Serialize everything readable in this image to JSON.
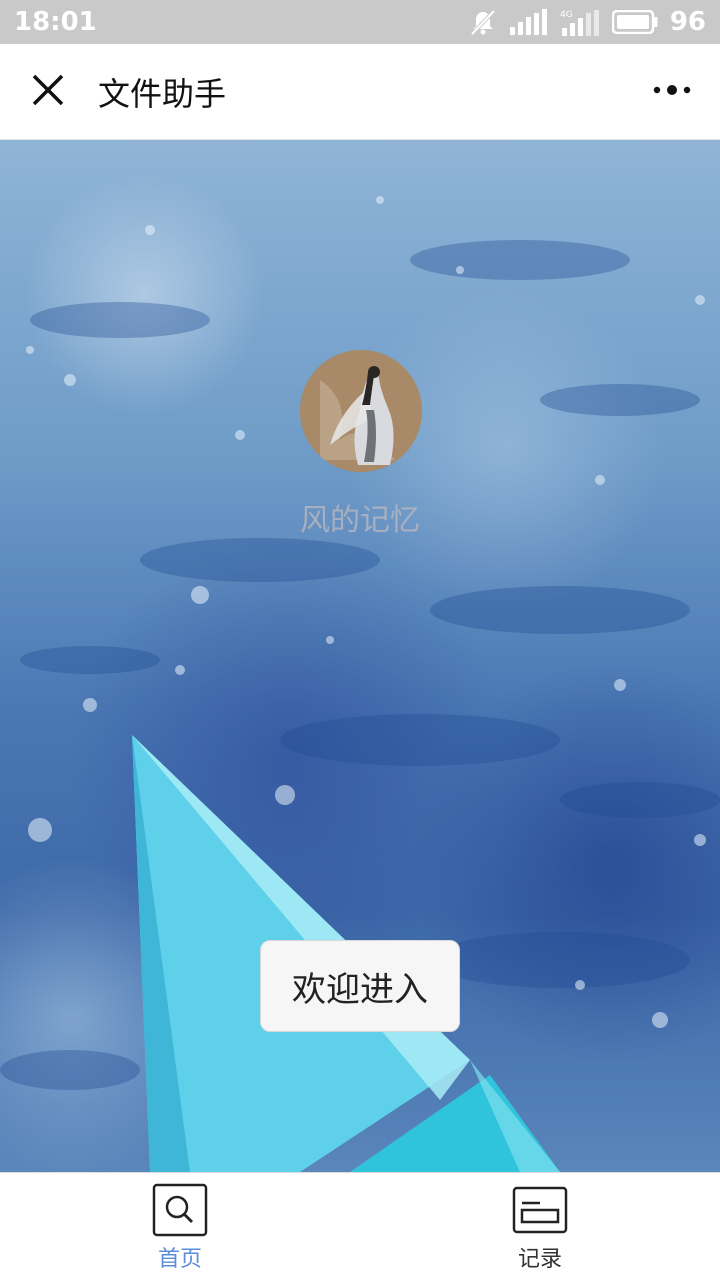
{
  "status_bar": {
    "time": "18:01",
    "battery_percent": "96",
    "network_label": "4G",
    "icons": [
      "mute-icon",
      "signal-icon",
      "signal-4g-icon",
      "battery-icon"
    ]
  },
  "header": {
    "title": "文件助手",
    "close_icon": "close-icon",
    "more_icon": "more-icon"
  },
  "profile": {
    "username": "风的记忆"
  },
  "welcome_button": {
    "label": "欢迎进入"
  },
  "tabbar": {
    "active_color": "#5b8ed8",
    "items": [
      {
        "label": "首页",
        "icon": "search-icon",
        "active": true
      },
      {
        "label": "记录",
        "icon": "records-icon",
        "active": false
      }
    ]
  }
}
